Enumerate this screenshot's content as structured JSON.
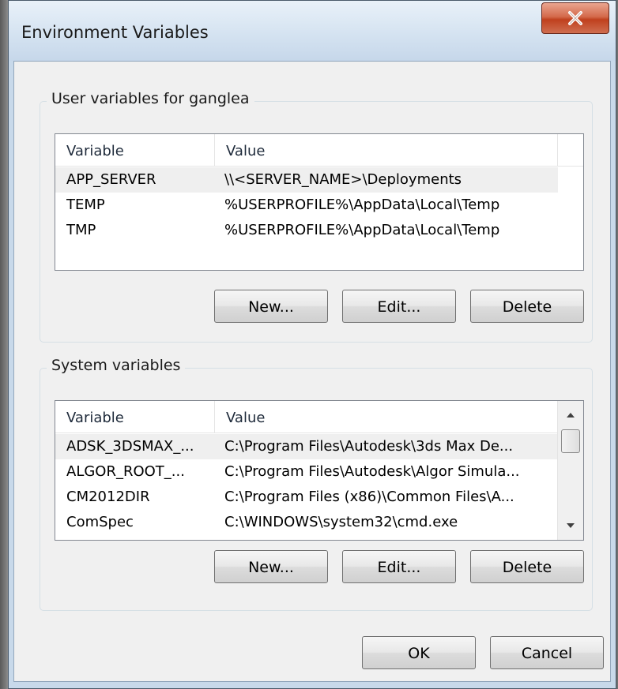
{
  "window": {
    "title": "Environment Variables",
    "close_label": "X"
  },
  "user_vars": {
    "group_label": "User variables for ganglea",
    "columns": {
      "variable": "Variable",
      "value": "Value"
    },
    "rows": [
      {
        "variable": "APP_SERVER",
        "value": "\\\\<SERVER_NAME>\\Deployments",
        "selected": true
      },
      {
        "variable": "TEMP",
        "value": "%USERPROFILE%\\AppData\\Local\\Temp",
        "selected": false
      },
      {
        "variable": "TMP",
        "value": "%USERPROFILE%\\AppData\\Local\\Temp",
        "selected": false
      }
    ],
    "new_label": "New...",
    "edit_label": "Edit...",
    "delete_label": "Delete"
  },
  "system_vars": {
    "group_label": "System variables",
    "columns": {
      "variable": "Variable",
      "value": "Value"
    },
    "rows": [
      {
        "variable": "ADSK_3DSMAX_...",
        "value": "C:\\Program Files\\Autodesk\\3ds Max De...",
        "selected": true
      },
      {
        "variable": "ALGOR_ROOT_...",
        "value": "C:\\Program Files\\Autodesk\\Algor Simula...",
        "selected": false
      },
      {
        "variable": "CM2012DIR",
        "value": "C:\\Program Files (x86)\\Common Files\\A...",
        "selected": false
      },
      {
        "variable": "ComSpec",
        "value": "C:\\WINDOWS\\system32\\cmd.exe",
        "selected": false
      }
    ],
    "new_label": "New...",
    "edit_label": "Edit...",
    "delete_label": "Delete"
  },
  "footer": {
    "ok_label": "OK",
    "cancel_label": "Cancel"
  },
  "icons": {
    "close": "close-icon",
    "scroll_up": "scroll-up-arrow-icon",
    "scroll_down": "scroll-down-arrow-icon"
  },
  "colors": {
    "titlebar": "#d5e3f1",
    "close_button": "#c94a2b",
    "client_bg": "#f0f0f0",
    "selected_row": "#efefef"
  }
}
